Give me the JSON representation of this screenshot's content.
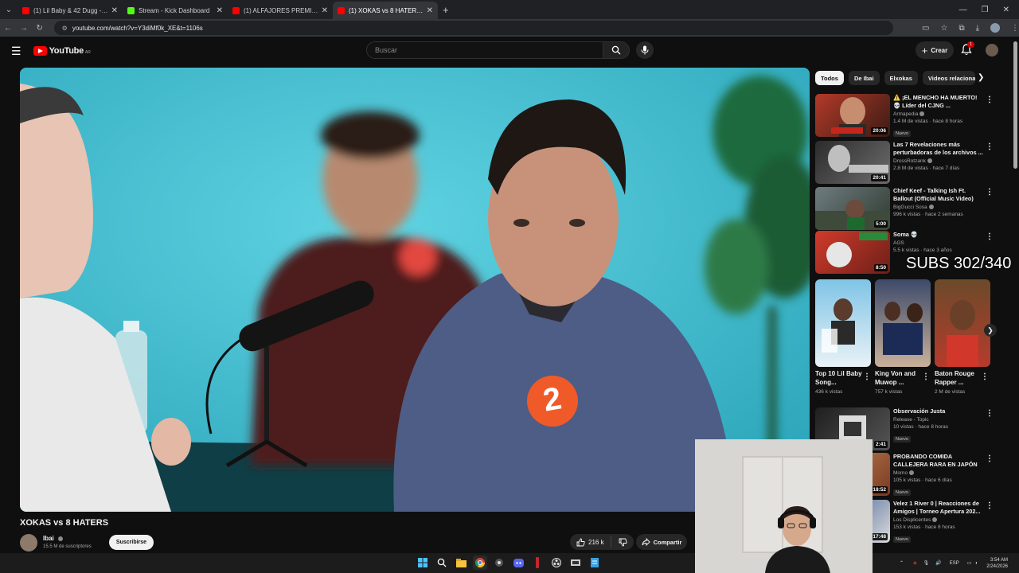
{
  "browser": {
    "tabs": [
      {
        "title": "(1) Lil Baby & 42 Dugg - Grace",
        "color": "#ff0000",
        "active": false
      },
      {
        "title": "Stream - Kick Dashboard",
        "color": "#53fc18",
        "active": false
      },
      {
        "title": "(1) ALFAJORES PREMIUM VERA",
        "color": "#ff0000",
        "active": false
      },
      {
        "title": "(1) XOKAS vs 8 HATERS - YouTu",
        "color": "#ff0000",
        "active": true
      }
    ],
    "url": "youtube.com/watch?v=Y3diMf0k_XE&t=1106s"
  },
  "header": {
    "logo_text": "YouTube",
    "country": "AR",
    "search_placeholder": "Buscar",
    "create_label": "Crear",
    "notification_count": "1"
  },
  "video": {
    "title": "XOKAS vs 8 HATERS",
    "channel": "Ibai",
    "subscribers": "15.5 M de suscriptores",
    "subscribe_label": "Suscribirse",
    "likes": "216 k",
    "share_label": "Compartir"
  },
  "chips": [
    "Todos",
    "De Ibai",
    "Elxokas",
    "Videos relacionados"
  ],
  "recommendations": [
    {
      "title": "⚠️ ¡EL MENCHO HA MUERTO! 💀 Líder del CJNG ...",
      "channel": "Armapedia",
      "meta": "1.4 M de vistas · hace 8 horas",
      "duration": "20:06",
      "badge": "Nuevo"
    },
    {
      "title": "Las 7 Revelaciones más perturbadoras de los archivos ...",
      "channel": "DrossRotzank",
      "meta": "2.8 M de vistas · hace 7 días",
      "duration": "20:41",
      "badge": ""
    },
    {
      "title": "Chief Keef - Talking Ish Ft. Ballout (Official Music Video)",
      "channel": "BigGucci Sosa",
      "meta": "996 k vistas · hace 2 semanas",
      "duration": "5:00",
      "badge": ""
    },
    {
      "title": "Soma 💀",
      "channel": "AGS",
      "meta": "5.5 k vistas · hace 3 años",
      "duration": "8:50",
      "badge": ""
    },
    {
      "title": "Observación Justa",
      "channel": "Release - Topic",
      "meta": "10 vistas · hace 8 horas",
      "duration": "2:41",
      "badge": "Nuevo"
    },
    {
      "title": "PROBANDO COMIDA CALLEJERA RARA EN JAPÓN",
      "channel": "Momo",
      "meta": "105 k vistas · hace 6 días",
      "duration": "18:52",
      "badge": "Nuevo"
    },
    {
      "title": "Velez 1 River 0 | Reacciones de Amigos | Torneo Apertura 202...",
      "channel": "Los Displicentes",
      "meta": "153 k vistas · hace 8 horas",
      "duration": "17:48",
      "badge": "Nuevo"
    }
  ],
  "shorts": [
    {
      "title": "Top 10 Lil Baby Song...",
      "views": "436 k vistas"
    },
    {
      "title": "King Von and Muwop ...",
      "views": "757 k vistas"
    },
    {
      "title": "Baton Rouge Rapper ...",
      "views": "2 M de vistas"
    }
  ],
  "overlay": {
    "subs_text": "SUBS 302/340"
  },
  "taskbar": {
    "lang": "ESP",
    "time": "3:54 AM",
    "date": "2/24/2026"
  }
}
